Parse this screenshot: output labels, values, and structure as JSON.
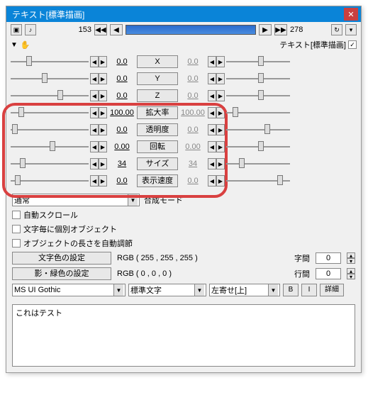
{
  "title": "テキスト[標準描画]",
  "frame_start": "153",
  "frame_end": "278",
  "sub_label": "テキスト[標準描画]",
  "sub_checked": "✓",
  "params": [
    {
      "label": "X",
      "lv": "0.0",
      "rv": "0.0",
      "lt": 20,
      "rt": 50
    },
    {
      "label": "Y",
      "lv": "0.0",
      "rv": "0.0",
      "lt": 40,
      "rt": 50
    },
    {
      "label": "Z",
      "lv": "0.0",
      "rv": "0.0",
      "lt": 60,
      "rt": 50
    },
    {
      "label": "拡大率",
      "lv": "100.00",
      "rv": "100.00",
      "lt": 10,
      "rt": 10
    },
    {
      "label": "透明度",
      "lv": "0.0",
      "rv": "0.0",
      "lt": 2,
      "rt": 60
    },
    {
      "label": "回転",
      "lv": "0.00",
      "rv": "0.00",
      "lt": 50,
      "rt": 50
    },
    {
      "label": "サイズ",
      "lv": "34",
      "rv": "34",
      "lt": 12,
      "rt": 20
    },
    {
      "label": "表示速度",
      "lv": "0.0",
      "rv": "0.0",
      "lt": 5,
      "rt": 80
    }
  ],
  "blend_mode": "通常",
  "blend_label": "合成モード",
  "checks": [
    "自動スクロール",
    "文字毎に個別オブジェクト",
    "オブジェクトの長さを自動調節"
  ],
  "color_btn": "文字色の設定",
  "shadow_btn": "影・緑色の設定",
  "color_rgb": "RGB ( 255 , 255 , 255 )",
  "shadow_rgb": "RGB ( 0 , 0 , 0 )",
  "spacing_label": "字間",
  "spacing_val": "0",
  "line_label": "行間",
  "line_val": "0",
  "font": "MS UI Gothic",
  "style": "標準文字",
  "align": "左寄せ[上]",
  "btn_b": "B",
  "btn_i": "I",
  "btn_detail": "詳細",
  "text_content": "これはテスト"
}
